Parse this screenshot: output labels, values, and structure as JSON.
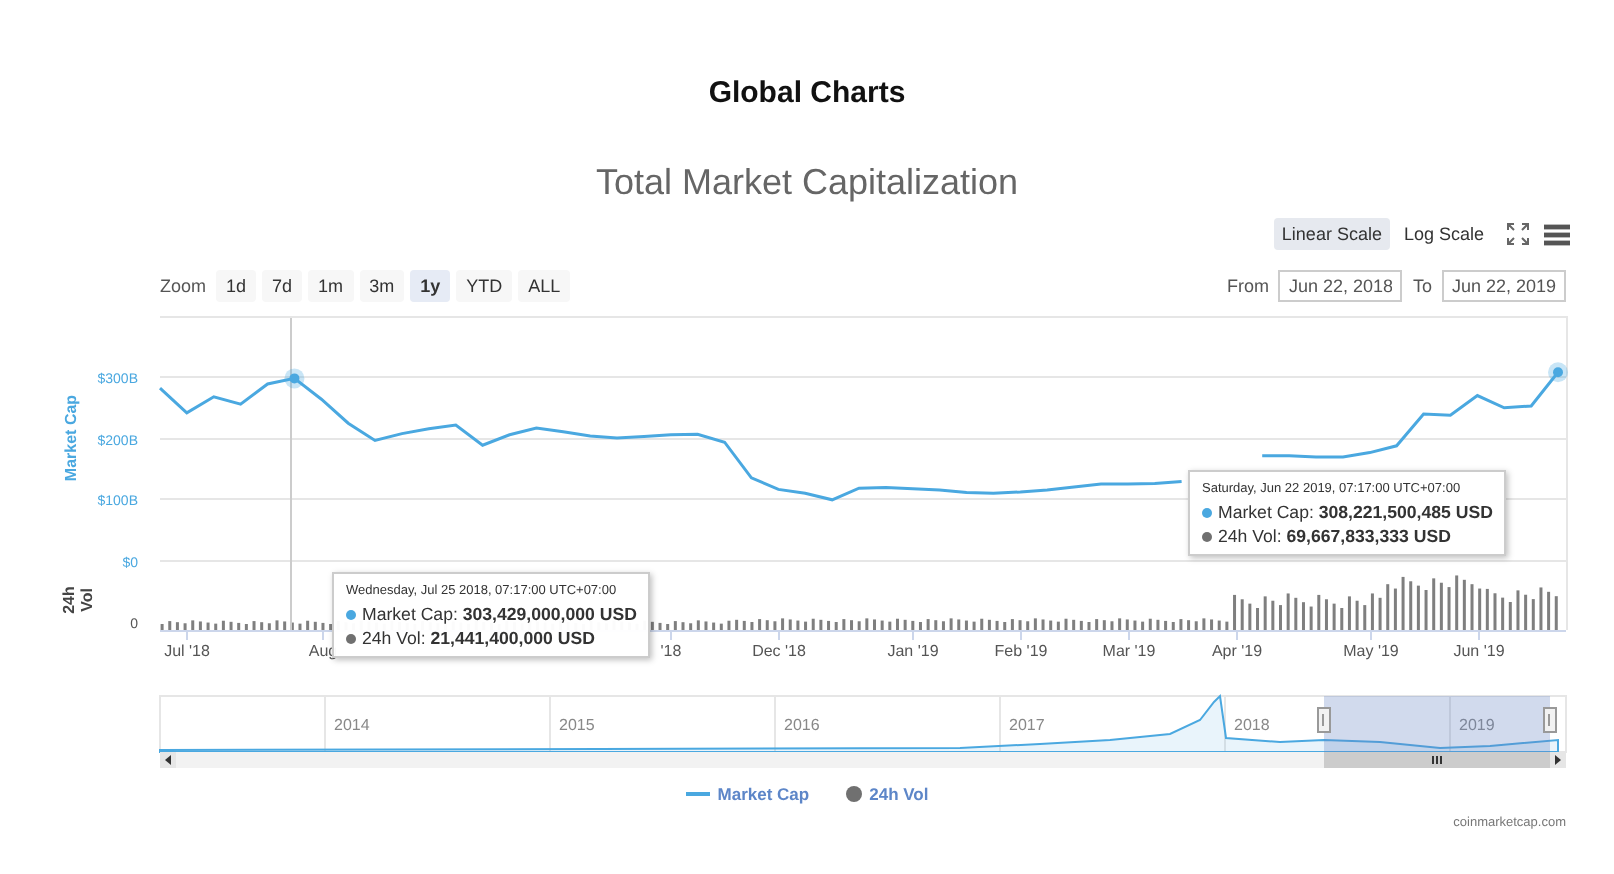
{
  "page_title": "Global Charts",
  "chart": {
    "title": "Total Market Capitalization",
    "scale_buttons": [
      {
        "label": "Linear Scale",
        "selected": true
      },
      {
        "label": "Log Scale",
        "selected": false
      }
    ],
    "zoom_label": "Zoom",
    "zoom_buttons": [
      {
        "label": "1d",
        "selected": false
      },
      {
        "label": "7d",
        "selected": false
      },
      {
        "label": "1m",
        "selected": false
      },
      {
        "label": "3m",
        "selected": false
      },
      {
        "label": "1y",
        "selected": true
      },
      {
        "label": "YTD",
        "selected": false
      },
      {
        "label": "ALL",
        "selected": false
      }
    ],
    "from_label": "From",
    "from_value": "Jun 22, 2018",
    "to_label": "To",
    "to_value": "Jun 22, 2019",
    "volume_title": "24h Vol",
    "volume_ticks": [
      "0"
    ],
    "chart_data": {
      "type": "line",
      "ylabel": "Market Cap",
      "categories": [
        null,
        "Jul '18",
        null,
        null,
        null,
        null,
        "Aug",
        null,
        null,
        null,
        null,
        null,
        null,
        null,
        null,
        null,
        null,
        null,
        null,
        "'18",
        null,
        null,
        null,
        "Dec '18",
        null,
        null,
        null,
        null,
        "Jan '19",
        null,
        null,
        null,
        "Feb '19",
        null,
        null,
        null,
        "Mar '19",
        null,
        null,
        null,
        "Apr '19",
        null,
        null,
        null,
        null,
        "May '19",
        null,
        null,
        null,
        "Jun '19",
        null,
        null,
        null
      ],
      "series": [
        {
          "name": "Market Cap",
          "color": "#4aa8e0",
          "values": [
            280,
            240,
            266,
            254,
            287,
            296,
            262,
            223,
            195,
            206,
            214,
            220,
            187,
            204,
            215,
            209,
            202,
            199,
            201,
            204,
            205,
            192,
            134,
            115,
            109,
            98,
            117,
            118,
            116,
            114,
            110,
            109,
            111,
            114,
            119,
            124,
            124,
            125,
            128,
            null,
            null,
            170,
            170,
            168,
            168,
            175,
            186,
            238,
            236,
            268,
            248,
            251,
            306
          ]
        }
      ],
      "ylim": [
        0,
        400
      ],
      "grid": true,
      "yticks": [
        {
          "value": 0,
          "label": "$0"
        },
        {
          "value": 100,
          "label": "$100B"
        },
        {
          "value": 200,
          "label": "$200B"
        },
        {
          "value": 300,
          "label": "$300B"
        }
      ]
    },
    "tooltips": [
      {
        "date": "Wednesday, Jul 25 2018, 07:17:00 UTC+07:00",
        "items": [
          {
            "label": "Market Cap: **303,429,000,000 USD**",
            "color": "#4aa8e0"
          },
          {
            "label": "24h Vol: **21,441,400,000 USD**",
            "color": "#707070"
          }
        ]
      },
      {
        "date": "Saturday, Jun 22 2019, 07:17:00 UTC+07:00",
        "items": [
          {
            "label": "Market Cap: **308,221,500,485 USD**",
            "color": "#4aa8e0"
          },
          {
            "label": "24h Vol: **69,667,833,333 USD**",
            "color": "#707070"
          }
        ]
      }
    ],
    "navigator_years": [
      "2014",
      "2015",
      "2016",
      "2017",
      "2018",
      "2019"
    ],
    "legend": [
      {
        "label": "24h Vol",
        "kind": "circle",
        "color": "#707070"
      }
    ],
    "credits": "coinmarketcap.com"
  }
}
